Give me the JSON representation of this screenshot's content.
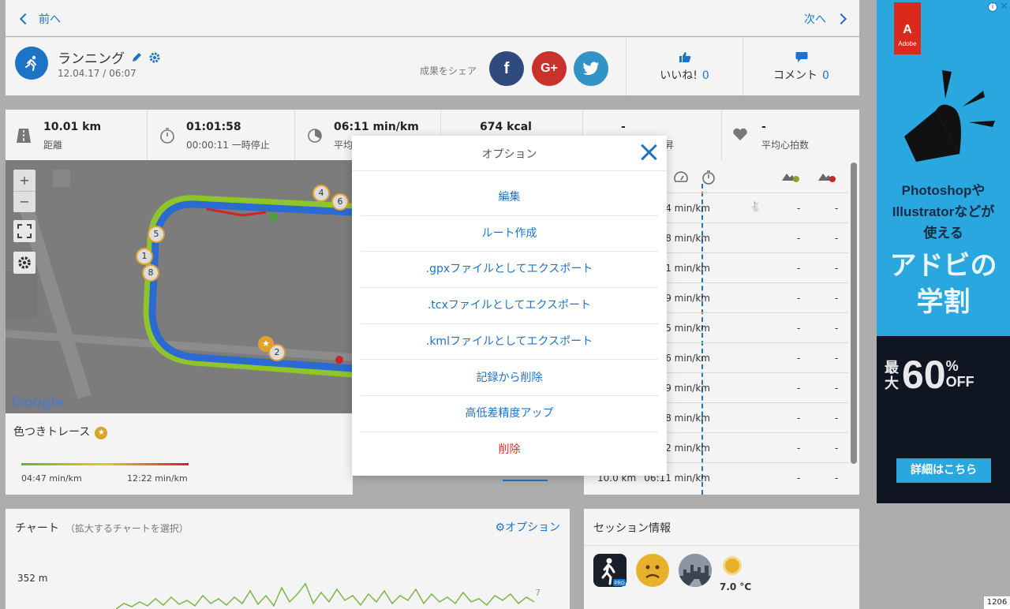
{
  "nav": {
    "prev": "前へ",
    "next": "次へ"
  },
  "activity": {
    "title": "ランニング",
    "date": "12.04.17 / 06:07",
    "share_label": "成果をシェア",
    "share": {
      "facebook": "f",
      "google": "G+"
    },
    "like_label": "いいね!",
    "like_count": "0",
    "comment_label": "コメント",
    "comment_count": "0"
  },
  "stats": [
    {
      "value": "10.01 km",
      "label": "距離"
    },
    {
      "value": "01:01:58",
      "label": "00:00:11 一時停止"
    },
    {
      "value": "06:11 min/km",
      "label": "平均"
    },
    {
      "value": "674 kcal",
      "label": ""
    },
    {
      "value": "-",
      "label": "昇"
    },
    {
      "value": "-",
      "label": "平均心拍数"
    }
  ],
  "map": {
    "zoom_in": "+",
    "zoom_out": "−",
    "google": "Google",
    "markers": [
      "1",
      "2",
      "4",
      "5",
      "6",
      "8"
    ]
  },
  "trace": {
    "title": "色つきトレース",
    "low": "04:47 min/km",
    "high": "12:22 min/km"
  },
  "laps": {
    "rows": [
      {
        "pace": "04 min/km",
        "d1": "-",
        "d2": "-"
      },
      {
        "pace": "38 min/km",
        "d1": "-",
        "d2": "-"
      },
      {
        "pace": "11 min/km",
        "d1": "-",
        "d2": "-"
      },
      {
        "pace": "19 min/km",
        "d1": "-",
        "d2": "-"
      },
      {
        "pace": "25 min/km",
        "d1": "-",
        "d2": "-"
      },
      {
        "pace": "46 min/km",
        "d1": "-",
        "d2": "-"
      },
      {
        "pace": "19 min/km",
        "d1": "-",
        "d2": "-"
      },
      {
        "pace": "18 min/km",
        "d1": "-",
        "d2": "-"
      },
      {
        "pace": "22 min/km",
        "d1": "-",
        "d2": "-"
      },
      {
        "pace": "06:11 min/km",
        "dist": "10.0 km",
        "d1": "-",
        "d2": "-"
      }
    ]
  },
  "chart": {
    "title": "チャート",
    "subtitle": "（拡大するチャートを選択）",
    "options": "オプション",
    "y_label": "352 m",
    "right_value": "7"
  },
  "session": {
    "title": "セッション情報",
    "app_badge": "PRO",
    "temperature": "7.0 °C"
  },
  "ad": {
    "brand": "Adobe",
    "brand_letter": "A",
    "headline_lines": [
      "Photoshopや",
      "Illustratorなどが",
      "使える"
    ],
    "big_lines": [
      "アドビの",
      "学割"
    ],
    "discount_prefix": "最大",
    "discount_value": "60",
    "discount_suffix_pct": "%",
    "discount_suffix_off": "OFF",
    "cta": "詳細はこちら",
    "info": "i",
    "close": "✕"
  },
  "modal": {
    "title": "オプション",
    "items": [
      "編集",
      "ルート作成",
      ".gpxファイルとしてエクスポート",
      ".tcxファイルとしてエクスポート",
      ".kmlファイルとしてエクスポート",
      "記録から削除",
      "高低差精度アップ",
      "削除"
    ]
  },
  "corner_badge": "1206",
  "colors": {
    "accent": "#1d74c7",
    "danger": "#d0312d"
  }
}
